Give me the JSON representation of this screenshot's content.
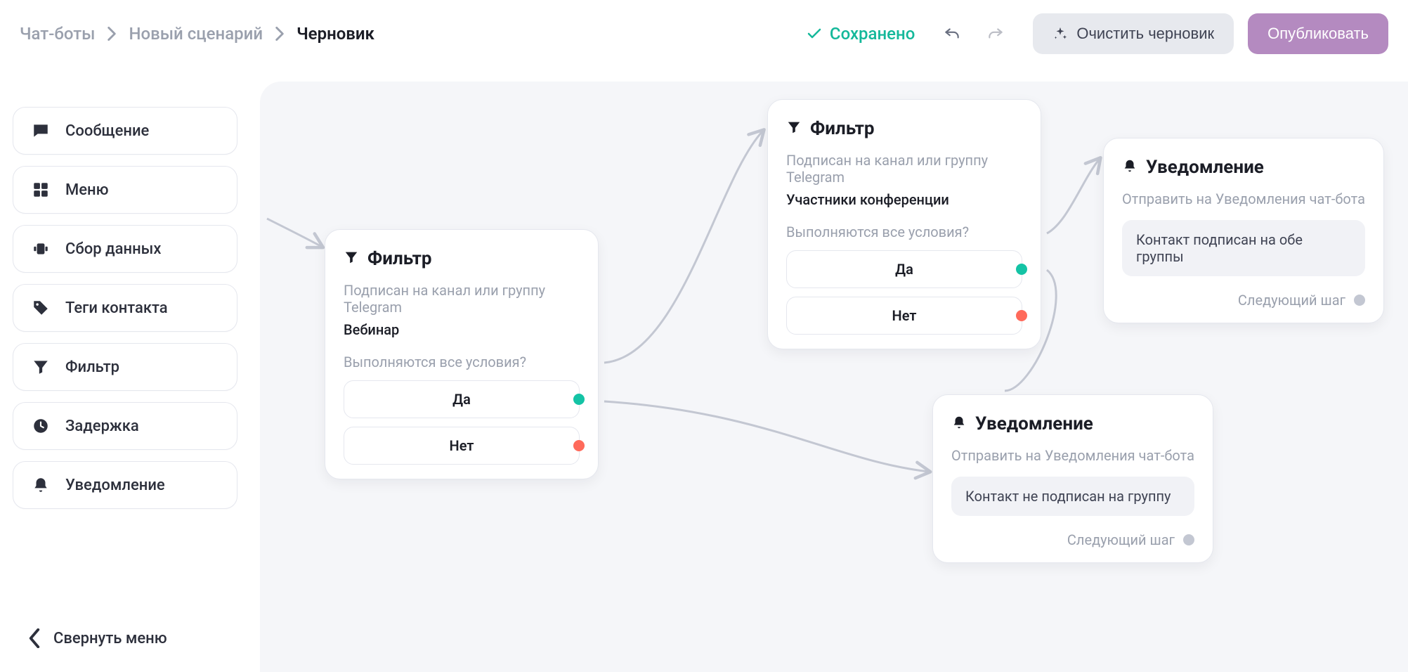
{
  "breadcrumb": {
    "chatbots": "Чат-боты",
    "new_scenario": "Новый сценарий",
    "draft": "Черновик"
  },
  "topbar": {
    "saved": "Сохранено",
    "clear_draft": "Очистить черновик",
    "publish": "Опубликовать"
  },
  "sidebar": {
    "items": [
      {
        "label": "Сообщение"
      },
      {
        "label": "Меню"
      },
      {
        "label": "Сбор данных"
      },
      {
        "label": "Теги контакта"
      },
      {
        "label": "Фильтр"
      },
      {
        "label": "Задержка"
      },
      {
        "label": "Уведомление"
      }
    ],
    "collapse": "Свернуть меню"
  },
  "nodes": {
    "filter1": {
      "title": "Фильтр",
      "sub": "Подписан на канал или группу Telegram",
      "value": "Вебинар",
      "question": "Выполняются все условия?",
      "yes": "Да",
      "no": "Нет"
    },
    "filter2": {
      "title": "Фильтр",
      "sub": "Подписан на канал или группу Telegram",
      "value": "Участники конференции",
      "question": "Выполняются все условия?",
      "yes": "Да",
      "no": "Нет"
    },
    "notif1": {
      "title": "Уведомление",
      "desc": "Отправить на Уведомления чат-бота",
      "msg": "Контакт подписан на обе группы",
      "next": "Следующий шаг"
    },
    "notif2": {
      "title": "Уведомление",
      "desc": "Отправить на Уведомления чат-бота",
      "msg": "Контакт не подписан на группу",
      "next": "Следующий шаг"
    }
  }
}
